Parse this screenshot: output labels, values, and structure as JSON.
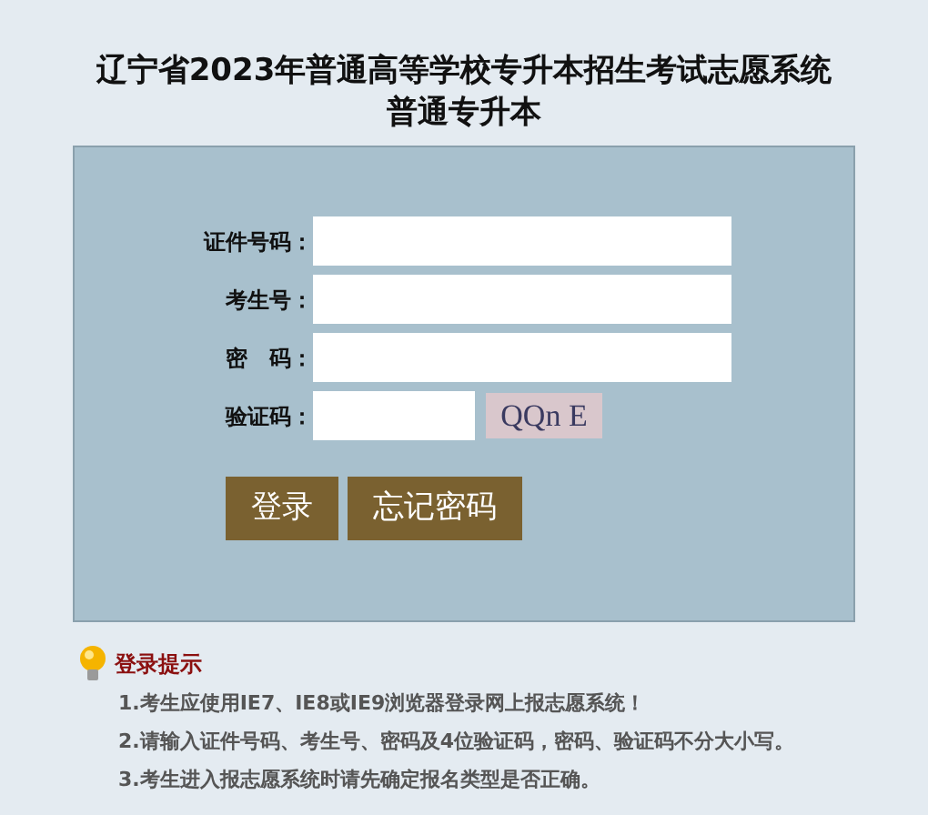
{
  "title": [
    "辽宁省2023年普通高等学校专升本招生考试志愿系统",
    "普通专升本"
  ],
  "form": {
    "fields": [
      {
        "kind": "text",
        "label": "证件号码："
      },
      {
        "kind": "text",
        "label": "考生号："
      },
      {
        "kind": "password",
        "label": "密　码："
      },
      {
        "kind": "captcha",
        "label": "验证码：",
        "captcha": "QQn E"
      }
    ],
    "buttons": [
      "登录",
      "忘记密码"
    ]
  },
  "tips": {
    "title": "登录提示",
    "items": [
      "1.考生应使用IE7、IE8或IE9浏览器登录网上报志愿系统！",
      "2.请输入证件号码、考生号、密码及4位验证码，密码、验证码不分大小写。",
      "3.考生进入报志愿系统时请先确定报名类型是否正确。"
    ]
  }
}
